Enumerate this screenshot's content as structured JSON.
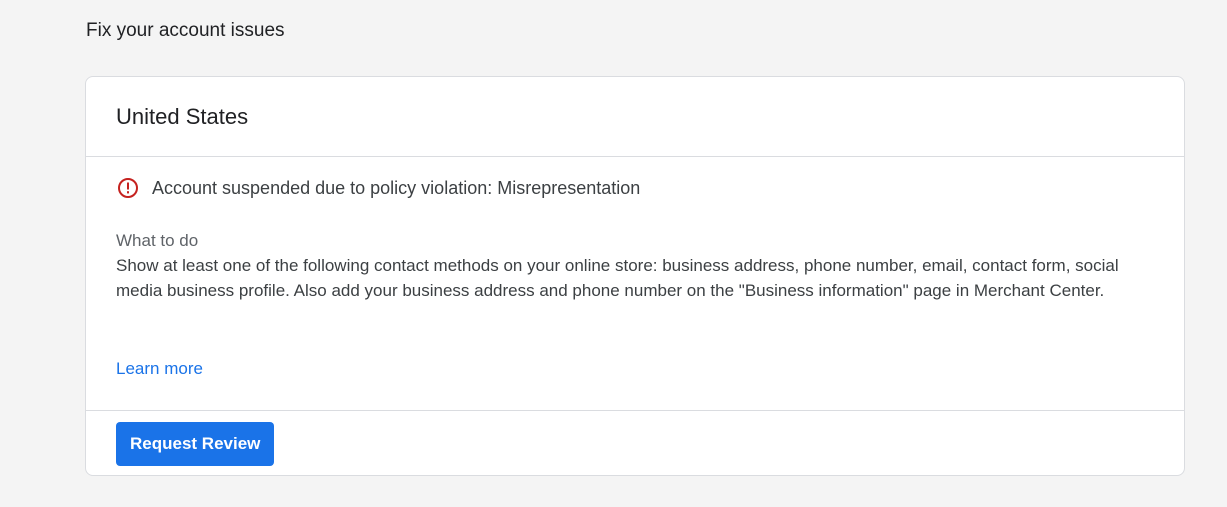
{
  "page": {
    "heading": "Fix your account issues"
  },
  "card": {
    "title": "United States",
    "issue": {
      "icon": "error-circle-icon",
      "icon_color": "#c5221f",
      "text": "Account suspended due to policy violation: Misrepresentation"
    },
    "what_to_do_label": "What to do",
    "what_to_do_text": "Show at least one of the following contact methods on your online store: business address, phone number, email, contact form, social media business profile. Also add your business address and phone number on the \"Business information\" page in Merchant Center.",
    "learn_more_label": "Learn more",
    "request_review_label": "Request Review"
  },
  "colors": {
    "accent": "#1a73e8",
    "error": "#c5221f",
    "background": "#f4f4f4",
    "card": "#ffffff",
    "divider": "#dadce0"
  }
}
